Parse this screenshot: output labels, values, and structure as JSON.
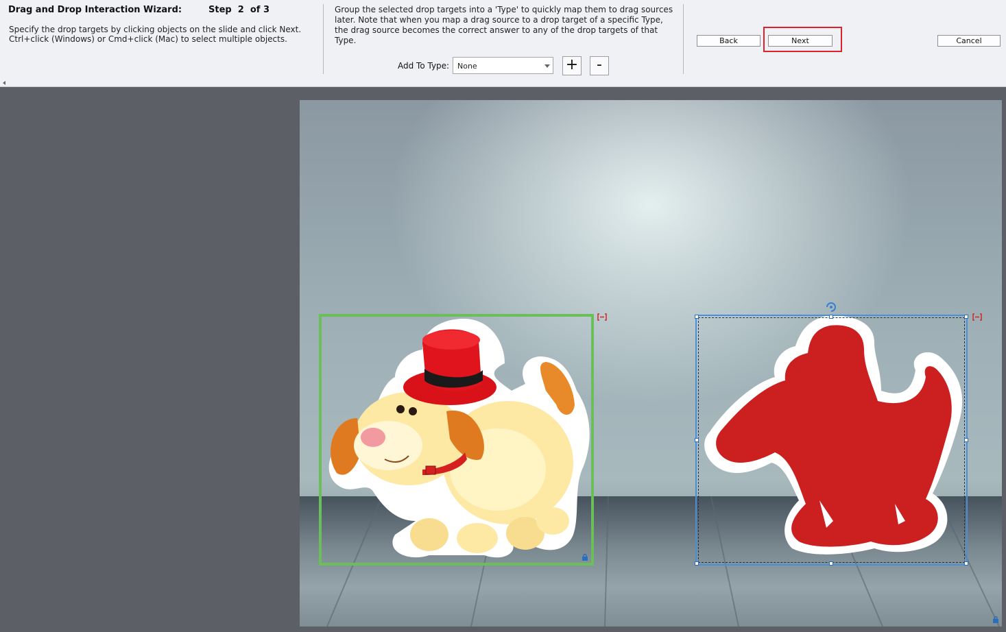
{
  "wizard": {
    "title": "Drag and Drop Interaction Wizard:",
    "step": "Step  2  of 3",
    "instructions": "Specify the drop targets by clicking objects on the slide and click Next. Ctrl+click (Windows) or Cmd+click (Mac) to select multiple objects.",
    "note": "Group the selected drop targets into a 'Type' to quickly map them to drag sources later. Note that when you map a drag source to a drop target of a specific Type, the drag source becomes the correct answer to any of the drop targets of that Type.",
    "add_to_type_label": "Add To Type:",
    "type_select": {
      "value": "None"
    },
    "add_type_label": "+",
    "remove_type_label": "-",
    "back_label": "Back",
    "next_label": "Next",
    "cancel_label": "Cancel",
    "highlight_color": "#e0202a"
  },
  "stage": {
    "objects": [
      {
        "name": "puppy-with-red-hat",
        "selection": "drop-source-green",
        "color": "#6bbf58"
      },
      {
        "name": "red-dog-silhouette",
        "selection": "selected-drop-target-blue",
        "color": "#4a90d9"
      }
    ]
  }
}
